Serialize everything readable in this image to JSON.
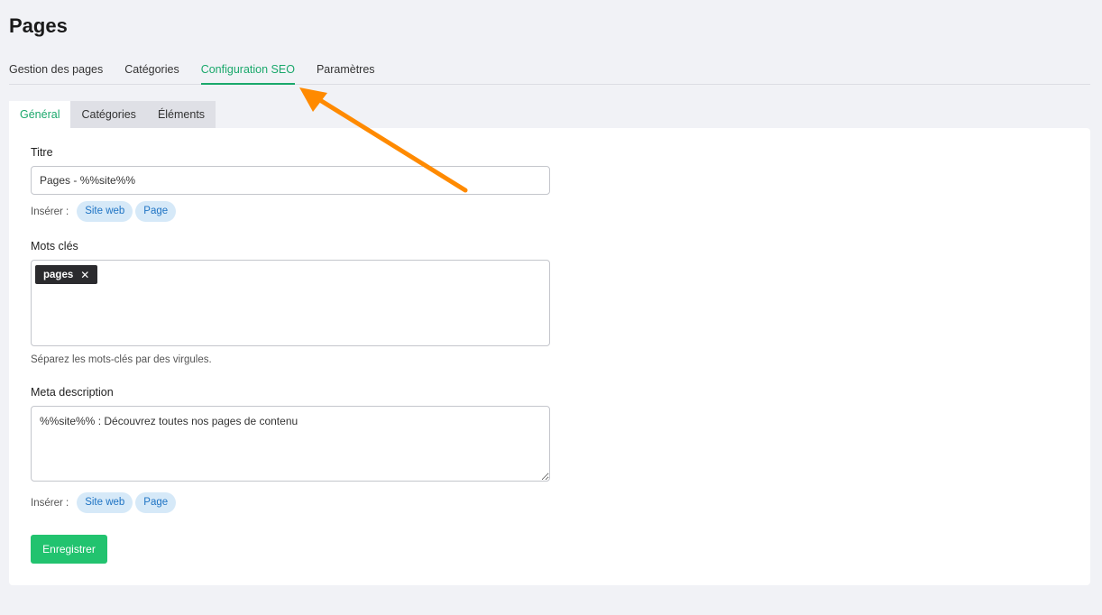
{
  "page": {
    "title": "Pages"
  },
  "main_tabs": [
    {
      "label": "Gestion des pages"
    },
    {
      "label": "Catégories"
    },
    {
      "label": "Configuration SEO"
    },
    {
      "label": "Paramètres"
    }
  ],
  "active_main_tab": "Configuration SEO",
  "sub_tabs": [
    {
      "label": "Général"
    },
    {
      "label": "Catégories"
    },
    {
      "label": "Éléments"
    }
  ],
  "active_sub_tab": "Général",
  "form": {
    "title": {
      "label": "Titre",
      "value": "Pages - %%site%%",
      "insert_label": "Insérer :",
      "chips": [
        "Site web",
        "Page"
      ]
    },
    "keywords": {
      "label": "Mots clés",
      "tags": [
        "pages"
      ],
      "remove_symbol": "✕",
      "help": "Séparez les mots-clés par des virgules."
    },
    "meta_description": {
      "label": "Meta description",
      "value": "%%site%% : Découvrez toutes nos pages de contenu",
      "insert_label": "Insérer :",
      "chips": [
        "Site web",
        "Page"
      ]
    },
    "save_label": "Enregistrer"
  },
  "annotation": {
    "arrow_color": "#ff8a00"
  },
  "colors": {
    "accent_green": "#1aa86b",
    "button_green": "#22c36f",
    "chip_bg": "#d6e9f8",
    "chip_text": "#1f74c4",
    "tag_bg": "#2b2b2e",
    "page_bg": "#f1f2f6"
  }
}
